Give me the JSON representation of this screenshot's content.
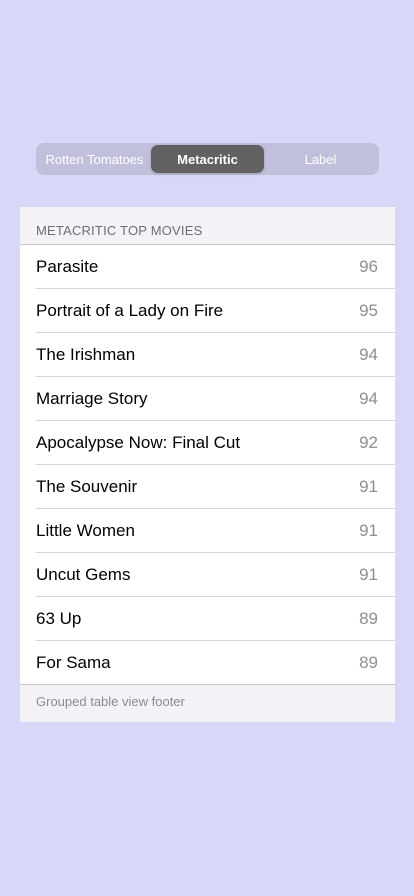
{
  "segmented_control": {
    "segments": [
      "Rotten Tomatoes",
      "Metacritic",
      "Label"
    ],
    "selected_index": 1
  },
  "table": {
    "header": "METACRITIC TOP MOVIES",
    "footer": "Grouped table view footer",
    "rows": [
      {
        "title": "Parasite",
        "score": "96"
      },
      {
        "title": "Portrait of a Lady on Fire",
        "score": "95"
      },
      {
        "title": "The Irishman",
        "score": "94"
      },
      {
        "title": "Marriage Story",
        "score": "94"
      },
      {
        "title": "Apocalypse Now: Final Cut",
        "score": "92"
      },
      {
        "title": "The Souvenir",
        "score": "91"
      },
      {
        "title": "Little Women",
        "score": "91"
      },
      {
        "title": "Uncut Gems",
        "score": "91"
      },
      {
        "title": "63 Up",
        "score": "89"
      },
      {
        "title": "For Sama",
        "score": "89"
      }
    ]
  },
  "colors": {
    "background": "#d7d8f8",
    "segment_selected": "#616161",
    "segment_track": "#c0c0dc"
  }
}
